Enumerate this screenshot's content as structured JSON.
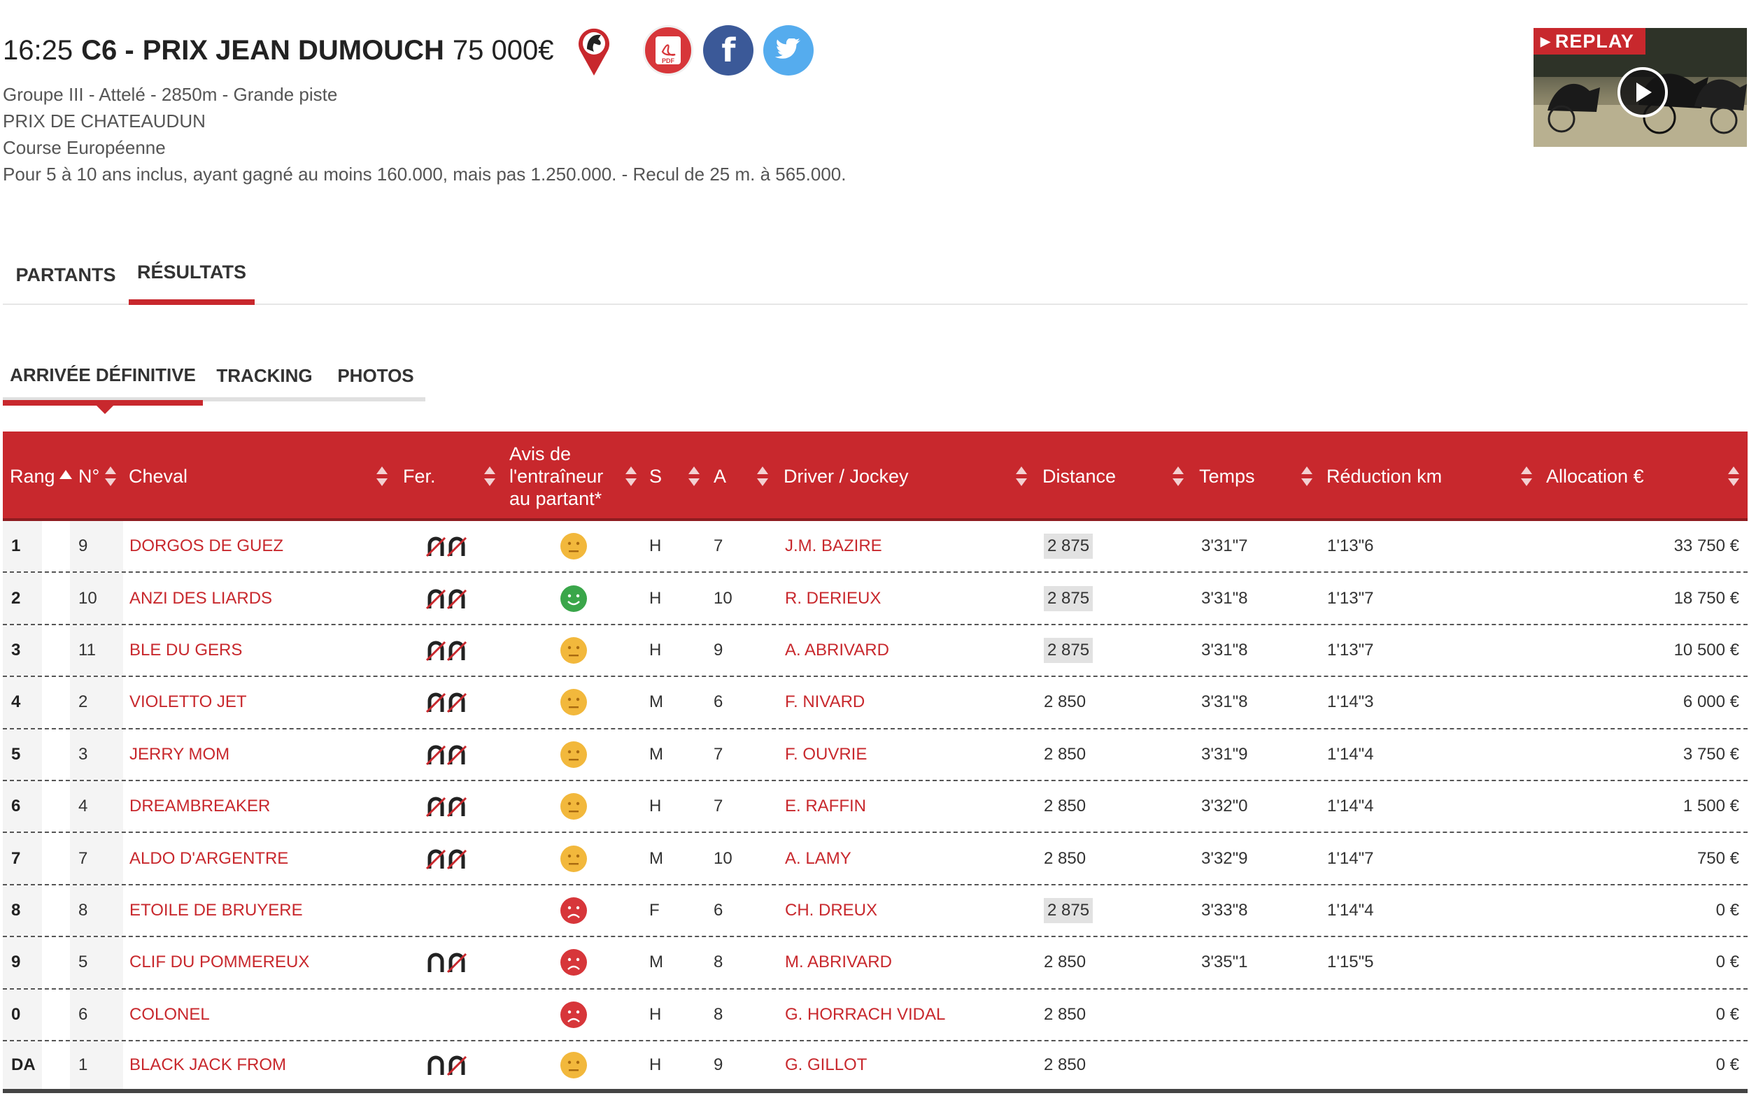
{
  "race": {
    "time": "16:25",
    "code": "C6 -",
    "name": "PRIX JEAN DUMOUCH",
    "prize": "75 000€",
    "info": [
      "Groupe III - Attelé - 2850m - Grande piste",
      "PRIX DE CHATEAUDUN",
      "Course Européenne",
      "Pour 5 à 10 ans inclus, ayant gagné au moins 160.000, mais pas 1.250.000. - Recul de 25 m. à 565.000."
    ],
    "icons": [
      "location-horse-icon",
      "pdf-icon",
      "facebook-icon",
      "twitter-icon"
    ],
    "pdf_label": "PDF",
    "fb_label": "f"
  },
  "replay": {
    "label": "REPLAY"
  },
  "tabs_main": [
    {
      "label": "PARTANTS",
      "active": false
    },
    {
      "label": "RÉSULTATS",
      "active": true
    }
  ],
  "tabs_sub": [
    {
      "label": "ARRIVÉE DÉFINITIVE",
      "active": true
    },
    {
      "label": "TRACKING",
      "active": false
    },
    {
      "label": "PHOTOS",
      "active": false
    }
  ],
  "colors": {
    "accent": "#c8282d",
    "neutral": "#f2b83c",
    "good": "#3aa64a",
    "bad": "#d7363a"
  },
  "table": {
    "headers": {
      "rang": "Rang",
      "num": "N°",
      "cheval": "Cheval",
      "fer": "Fer.",
      "avis": "Avis de l'entraîneur au partant*",
      "sexe": "S",
      "age": "A",
      "driver": "Driver / Jockey",
      "distance": "Distance",
      "temps": "Temps",
      "reduction": "Réduction km",
      "allocation": "Allocation €"
    },
    "rows": [
      {
        "rang": "1",
        "num": "9",
        "cheval": "DORGOS DE GUEZ",
        "fer": "D4",
        "avis": "neutral",
        "sexe": "H",
        "age": "7",
        "driver": "J.M. BAZIRE",
        "distance": "2 875",
        "dist_hl": true,
        "temps": "3'31\"7",
        "reduction": "1'13\"6",
        "allocation": "33 750 €"
      },
      {
        "rang": "2",
        "num": "10",
        "cheval": "ANZI DES LIARDS",
        "fer": "D4",
        "avis": "good",
        "sexe": "H",
        "age": "10",
        "driver": "R. DERIEUX",
        "distance": "2 875",
        "dist_hl": true,
        "temps": "3'31\"8",
        "reduction": "1'13\"7",
        "allocation": "18 750 €"
      },
      {
        "rang": "3",
        "num": "11",
        "cheval": "BLE DU GERS",
        "fer": "D4",
        "avis": "neutral",
        "sexe": "H",
        "age": "9",
        "driver": "A. ABRIVARD",
        "distance": "2 875",
        "dist_hl": true,
        "temps": "3'31\"8",
        "reduction": "1'13\"7",
        "allocation": "10 500 €"
      },
      {
        "rang": "4",
        "num": "2",
        "cheval": "VIOLETTO JET",
        "fer": "D4",
        "avis": "neutral",
        "sexe": "M",
        "age": "6",
        "driver": "F. NIVARD",
        "distance": "2 850",
        "dist_hl": false,
        "temps": "3'31\"8",
        "reduction": "1'14\"3",
        "allocation": "6 000 €"
      },
      {
        "rang": "5",
        "num": "3",
        "cheval": "JERRY MOM",
        "fer": "D4",
        "avis": "neutral",
        "sexe": "M",
        "age": "7",
        "driver": "F. OUVRIE",
        "distance": "2 850",
        "dist_hl": false,
        "temps": "3'31\"9",
        "reduction": "1'14\"4",
        "allocation": "3 750 €"
      },
      {
        "rang": "6",
        "num": "4",
        "cheval": "DREAMBREAKER",
        "fer": "D4",
        "avis": "neutral",
        "sexe": "H",
        "age": "7",
        "driver": "E. RAFFIN",
        "distance": "2 850",
        "dist_hl": false,
        "temps": "3'32\"0",
        "reduction": "1'14\"4",
        "allocation": "1 500 €"
      },
      {
        "rang": "7",
        "num": "7",
        "cheval": "ALDO D'ARGENTRE",
        "fer": "D4",
        "avis": "neutral",
        "sexe": "M",
        "age": "10",
        "driver": "A. LAMY",
        "distance": "2 850",
        "dist_hl": false,
        "temps": "3'32\"9",
        "reduction": "1'14\"7",
        "allocation": "750 €"
      },
      {
        "rang": "8",
        "num": "8",
        "cheval": "ETOILE DE BRUYERE",
        "fer": "",
        "avis": "bad",
        "sexe": "F",
        "age": "6",
        "driver": "CH. DREUX",
        "distance": "2 875",
        "dist_hl": true,
        "temps": "3'33\"8",
        "reduction": "1'14\"4",
        "allocation": "0 €"
      },
      {
        "rang": "9",
        "num": "5",
        "cheval": "CLIF DU POMMEREUX",
        "fer": "DP",
        "avis": "bad",
        "sexe": "M",
        "age": "8",
        "driver": "M. ABRIVARD",
        "distance": "2 850",
        "dist_hl": false,
        "temps": "3'35\"1",
        "reduction": "1'15\"5",
        "allocation": "0 €"
      },
      {
        "rang": "0",
        "num": "6",
        "cheval": "COLONEL",
        "fer": "",
        "avis": "bad",
        "sexe": "H",
        "age": "8",
        "driver": "G. HORRACH VIDAL",
        "distance": "2 850",
        "dist_hl": false,
        "temps": "",
        "reduction": "",
        "allocation": "0 €"
      },
      {
        "rang": "DA",
        "num": "1",
        "cheval": "BLACK JACK FROM",
        "fer": "DP",
        "avis": "neutral",
        "sexe": "H",
        "age": "9",
        "driver": "G. GILLOT",
        "distance": "2 850",
        "dist_hl": false,
        "temps": "",
        "reduction": "",
        "allocation": "0 €"
      }
    ]
  }
}
